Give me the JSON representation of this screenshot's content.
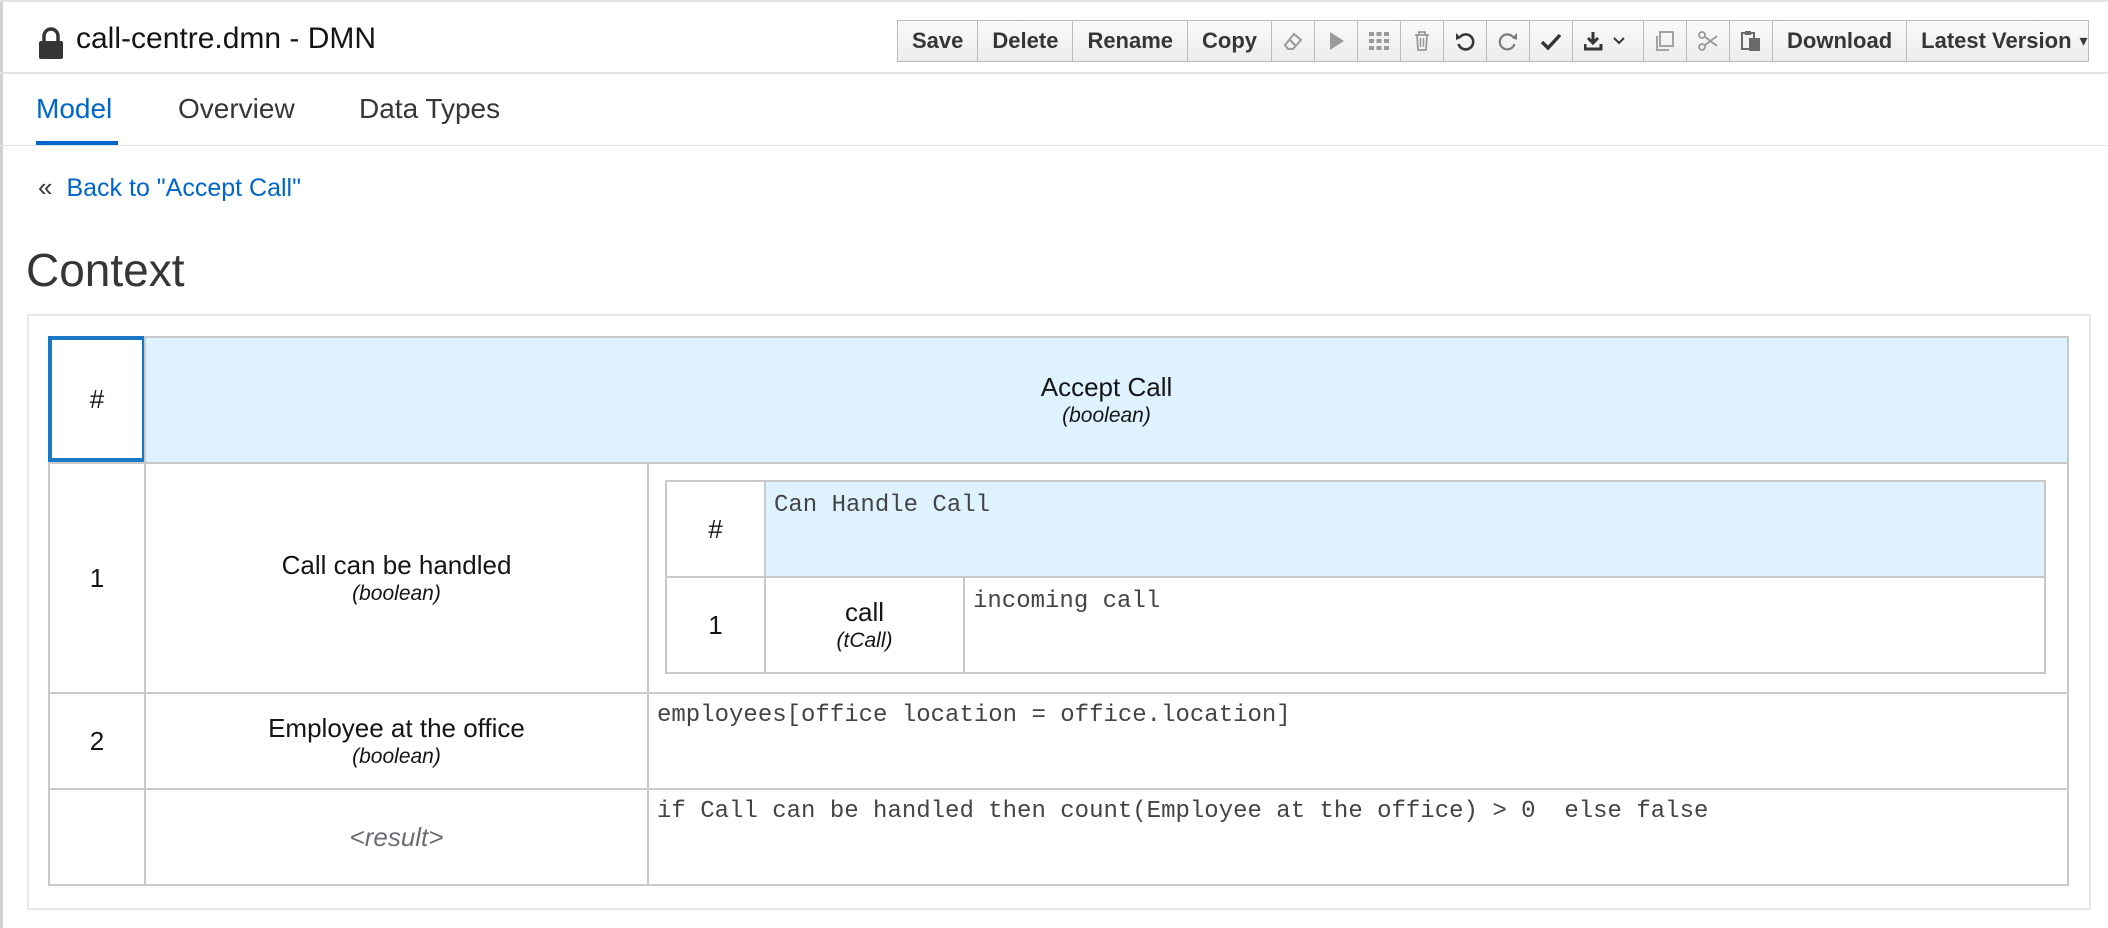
{
  "header": {
    "title": "call-centre.dmn - DMN"
  },
  "toolbar": {
    "save_label": "Save",
    "delete_label": "Delete",
    "rename_label": "Rename",
    "copy_label": "Copy",
    "download_label": "Download",
    "latest_version_label": "Latest Version",
    "icons": [
      "eraser-icon",
      "play-icon",
      "grid-icon",
      "trash-icon",
      "undo-icon",
      "redo-icon",
      "check-icon",
      "export-dropdown-icon",
      "copy-icon",
      "cut-icon",
      "paste-icon"
    ]
  },
  "tabs": [
    {
      "label": "Model",
      "active": true
    },
    {
      "label": "Overview",
      "active": false
    },
    {
      "label": "Data Types",
      "active": false
    }
  ],
  "back_link": "Back to \"Accept Call\"",
  "section_title": "Context",
  "context": {
    "header": {
      "hash": "#",
      "name": "Accept Call",
      "type": "(boolean)"
    },
    "rows": [
      {
        "index": "1",
        "name": "Call can be handled",
        "type": "(boolean)",
        "nested": {
          "hash": "#",
          "header": "Can Handle Call",
          "rows": [
            {
              "index": "1",
              "name": "call",
              "type": "(tCall)",
              "expression": "incoming call"
            }
          ]
        }
      },
      {
        "index": "2",
        "name": "Employee at the office",
        "type": "(boolean)",
        "expression": "employees[office location = office.location]"
      }
    ],
    "result": {
      "label": "<result>",
      "expression": "if Call can be handled then count(Employee at the office) > 0  else false"
    }
  },
  "colors": {
    "accent": "#0066cc",
    "header_bg": "#def3ff",
    "selected_border": "#1a79c7"
  }
}
